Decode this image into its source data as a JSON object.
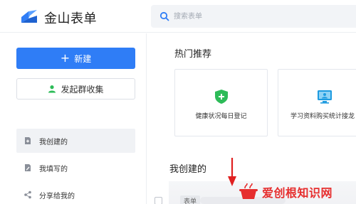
{
  "app": {
    "title": "金山表单"
  },
  "search": {
    "placeholder": "搜索表单"
  },
  "sidebar": {
    "new_label": "新建",
    "group_label": "发起群收集",
    "items": [
      {
        "label": "我创建的",
        "icon": "doc-plus-icon",
        "active": true
      },
      {
        "label": "我填写的",
        "icon": "edit-icon",
        "active": false
      },
      {
        "label": "分享给我的",
        "icon": "share-icon",
        "active": false
      }
    ]
  },
  "main": {
    "hot_title": "热门推荐",
    "cards": [
      {
        "label": "健康状况每日登记",
        "icon": "shield-plus-icon"
      },
      {
        "label": "学习资料购买统计接龙",
        "icon": "monitor-icon"
      }
    ],
    "mine_title": "我创建的",
    "row_tag": "表单"
  },
  "watermark": {
    "text": "爱创根知识网"
  },
  "colors": {
    "accent": "#2f7df6",
    "shield": "#2dbb58",
    "monitor": "#1e9be0",
    "arrow": "#e02020"
  }
}
